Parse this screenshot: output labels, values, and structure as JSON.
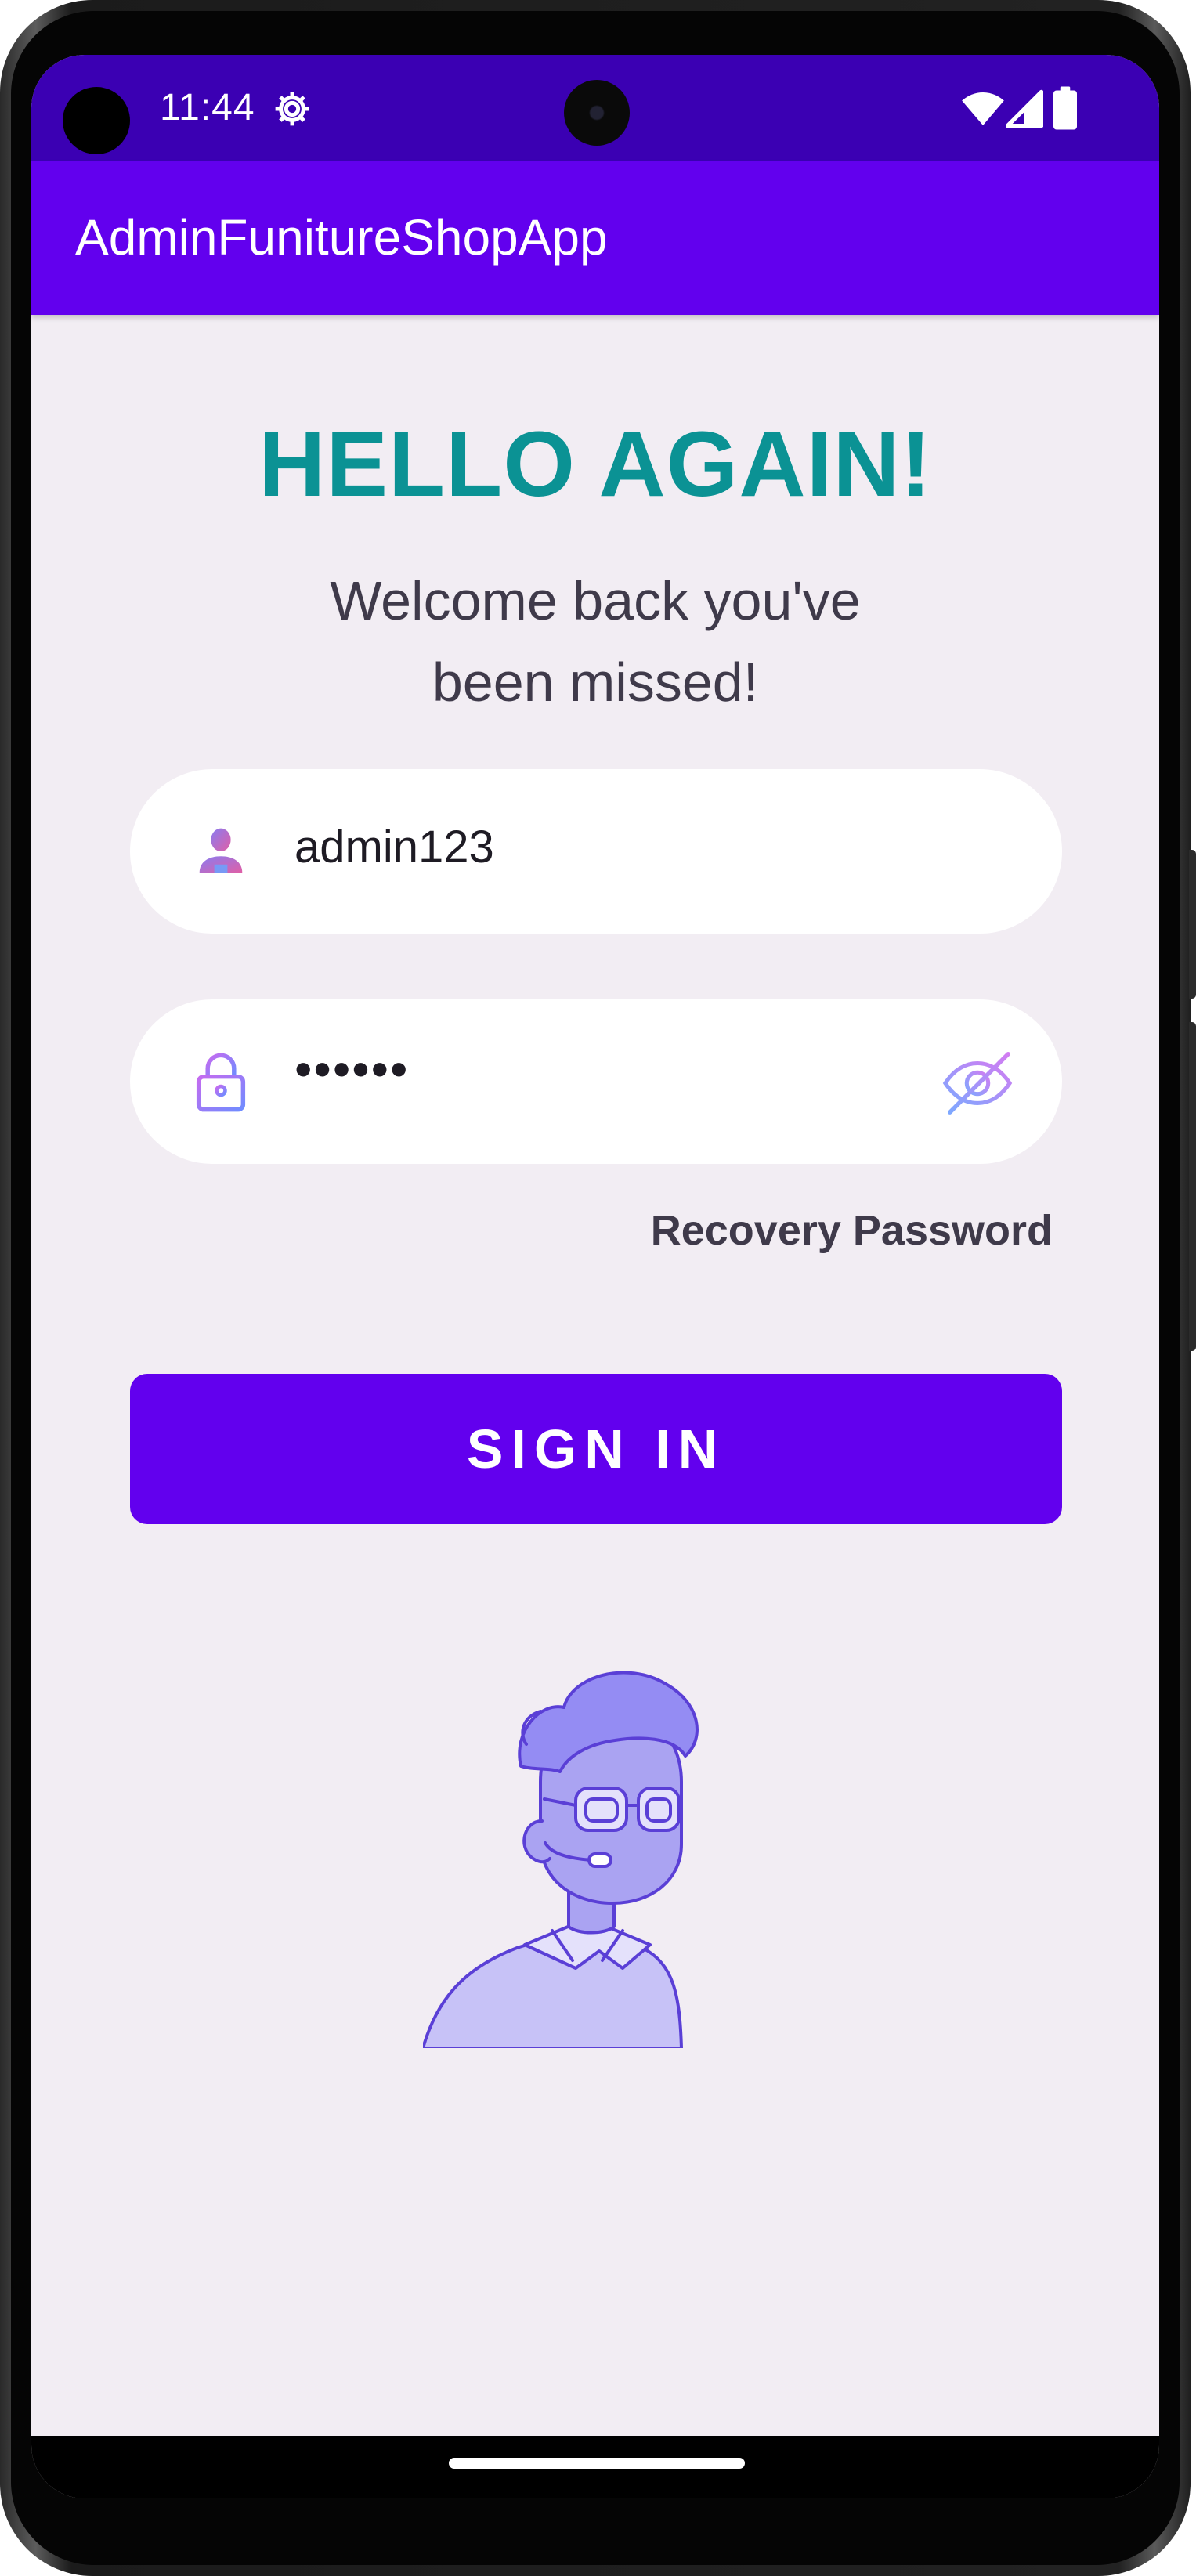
{
  "status_bar": {
    "time": "11:44",
    "icons": [
      "gear-icon",
      "wifi-icon",
      "signal-icon",
      "battery-icon"
    ]
  },
  "app_bar": {
    "title": "AdminFunitureShopApp"
  },
  "login": {
    "heading": "HELLO AGAIN!",
    "subtitle_line1": "Welcome back you've",
    "subtitle_line2": "been missed!",
    "username_value": "admin123",
    "password_mask": "••••••",
    "recovery_link": "Recovery Password",
    "signin_label": "SIGN IN"
  },
  "colors": {
    "status_bar": "#3b00b3",
    "app_bar": "#6200ee",
    "heading": "#0b9294",
    "background": "#f2edf3",
    "button": "#6200ee"
  }
}
